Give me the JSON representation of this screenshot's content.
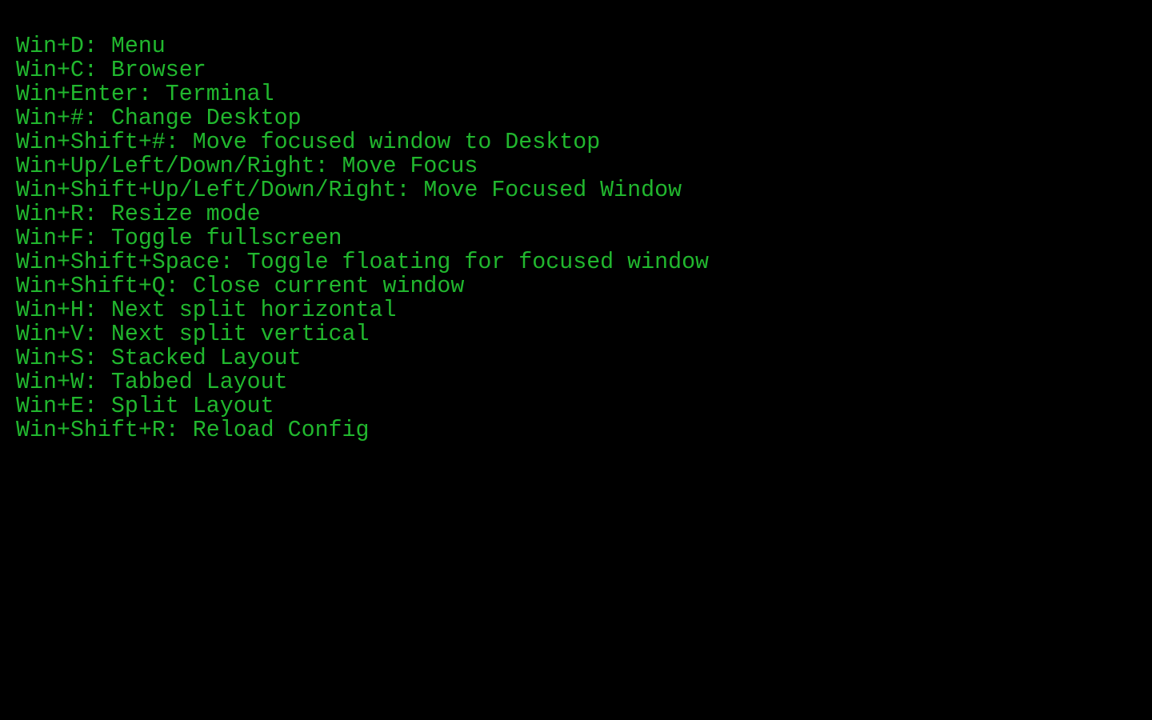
{
  "theme": {
    "background": "#000000",
    "text_color": "#21b72e"
  },
  "keybindings": [
    "Win+D: Menu",
    "Win+C: Browser",
    "Win+Enter: Terminal",
    "Win+#: Change Desktop",
    "Win+Shift+#: Move focused window to Desktop",
    "Win+Up/Left/Down/Right: Move Focus",
    "Win+Shift+Up/Left/Down/Right: Move Focused Window",
    "Win+R: Resize mode",
    "Win+F: Toggle fullscreen",
    "Win+Shift+Space: Toggle floating for focused window",
    "Win+Shift+Q: Close current window",
    "Win+H: Next split horizontal",
    "Win+V: Next split vertical",
    "Win+S: Stacked Layout",
    "Win+W: Tabbed Layout",
    "Win+E: Split Layout",
    "Win+Shift+R: Reload Config"
  ]
}
